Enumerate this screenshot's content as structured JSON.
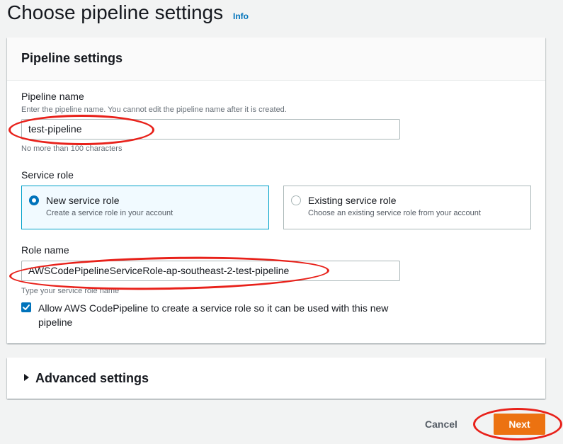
{
  "page": {
    "title": "Choose pipeline settings",
    "info_link": "Info"
  },
  "pipeline_settings": {
    "header": "Pipeline settings",
    "pipeline_name": {
      "label": "Pipeline name",
      "description": "Enter the pipeline name. You cannot edit the pipeline name after it is created.",
      "value": "test-pipeline",
      "constraint": "No more than 100 characters"
    },
    "service_role": {
      "label": "Service role",
      "options": [
        {
          "title": "New service role",
          "description": "Create a service role in your account",
          "selected": true
        },
        {
          "title": "Existing service role",
          "description": "Choose an existing service role from your account",
          "selected": false
        }
      ]
    },
    "role_name": {
      "label": "Role name",
      "value": "AWSCodePipelineServiceRole-ap-southeast-2-test-pipeline",
      "description": "Type your service role name"
    },
    "allow_checkbox": {
      "label": "Allow AWS CodePipeline to create a service role so it can be used with this new pipeline",
      "checked": true
    }
  },
  "advanced_settings": {
    "header": "Advanced settings",
    "expanded": false
  },
  "actions": {
    "cancel_label": "Cancel",
    "next_label": "Next"
  },
  "colors": {
    "accent": "#0073bb",
    "primary_button": "#ec7211",
    "annotation": "#e8211a",
    "selected_tile_border": "#00a1c9"
  }
}
